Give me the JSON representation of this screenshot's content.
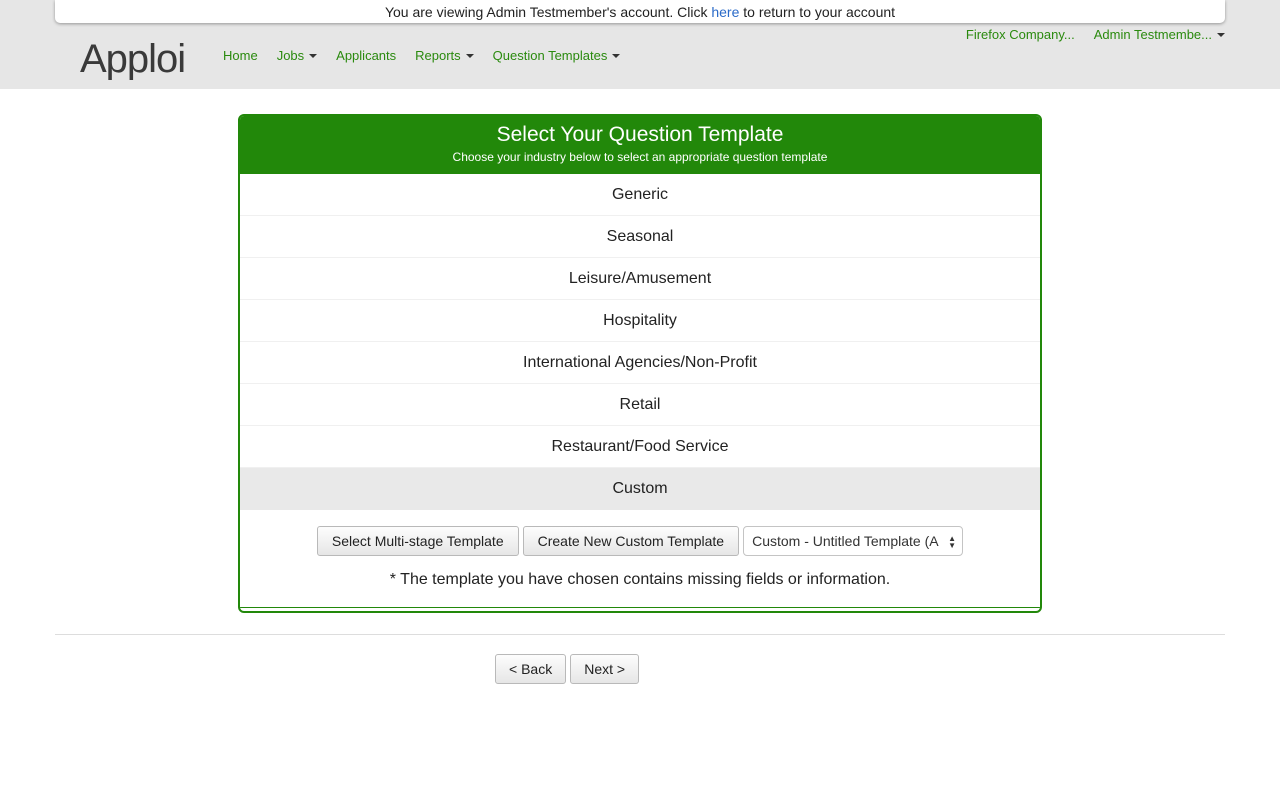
{
  "banner": {
    "prefix": "You are viewing Admin Testmember's account. Click ",
    "link": "here",
    "suffix": " to return to your account"
  },
  "brand": {
    "logo_text": "Apploi"
  },
  "nav": {
    "items": [
      {
        "label": "Home"
      },
      {
        "label": "Jobs"
      },
      {
        "label": "Applicants"
      },
      {
        "label": "Reports"
      },
      {
        "label": "Question Templates"
      }
    ]
  },
  "account": {
    "company": "Firefox Company...",
    "user": "Admin Testmembe..."
  },
  "panel": {
    "title": "Select Your Question Template",
    "subtitle": "Choose your industry below to select an appropriate question template",
    "industries": [
      "Generic",
      "Seasonal",
      "Leisure/Amusement",
      "Hospitality",
      "International Agencies/Non-Profit",
      "Retail",
      "Restaurant/Food Service",
      "Custom"
    ],
    "selected_industry": "Custom",
    "multistage_button": "Select Multi-stage Template",
    "create_button": "Create New Custom Template",
    "template_select_value": "Custom - Untitled Template (A",
    "warning": "* The template you have chosen contains missing fields or information."
  },
  "pager": {
    "back": "< Back",
    "next": "Next >"
  },
  "colors": {
    "brand_green": "#22880a",
    "nav_green": "#2a8a0e",
    "link_blue": "#2a6ac8"
  }
}
